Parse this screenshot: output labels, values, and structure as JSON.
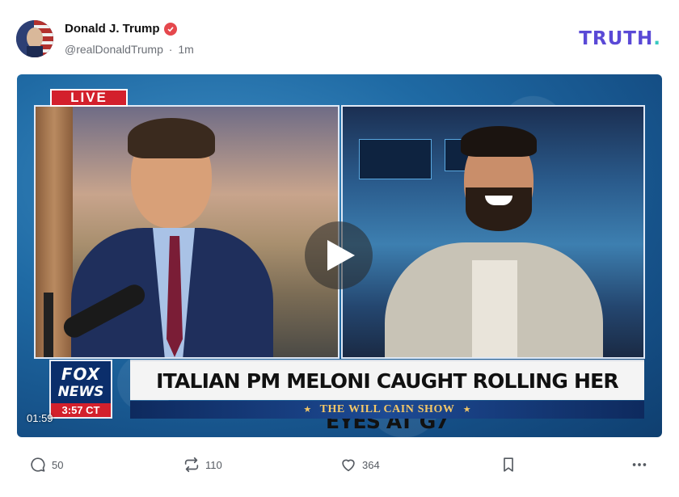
{
  "post": {
    "author_name": "Donald J. Trump",
    "handle": "@realDonaldTrump",
    "separator": "·",
    "time_ago": "1m"
  },
  "brand": {
    "logo_text": "TRUTH",
    "logo_dot": ".",
    "logo_color": "#5a49d6",
    "logo_dot_color": "#38c9c0"
  },
  "video": {
    "live_label": "LIVE",
    "headline": "ITALIAN PM MELONI CAUGHT ROLLING HER EYES AT G7",
    "show_prefix": "THE",
    "show_name": "WILL CAIN",
    "show_suffix": "SHOW",
    "network_line1": "FOX",
    "network_line2": "NEWS",
    "clock": "3:57 CT",
    "duration": "01:59"
  },
  "actions": {
    "reply_count": "50",
    "retruth_count": "110",
    "like_count": "364"
  },
  "icons": [
    "verified-badge-icon",
    "play-icon",
    "reply-icon",
    "retruth-icon",
    "heart-icon",
    "bookmark-icon",
    "more-icon"
  ],
  "colors": {
    "verified": "#e5484d",
    "live_red": "#d3202c",
    "fox_blue": "#0b2e6b"
  }
}
